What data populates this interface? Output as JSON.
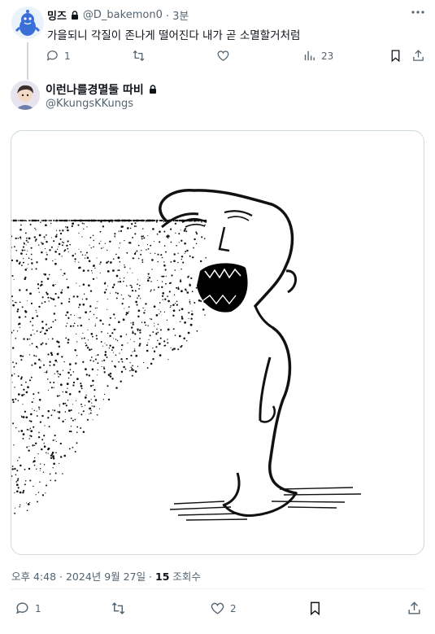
{
  "parent_tweet": {
    "display_name": "밍즈",
    "handle": "@D_bakemon0",
    "time": "· 3분",
    "text": "가을되니 각질이 존나게 떨어진다 내가 곧 소멸할거처럼",
    "replies": "1",
    "views": "23"
  },
  "main_tweet": {
    "display_name": "이런나를경멸둘 따비",
    "handle": "@KkungsKKungs",
    "timestamp": "오후 4:48 · 2024년 9월 27일 · ",
    "views_count": "15",
    "views_label": " 조회수",
    "replies": "1",
    "likes": "2"
  },
  "icons": {
    "lock": "lock-icon",
    "reply": "reply-icon",
    "retweet": "retweet-icon",
    "like": "heart-icon",
    "views": "views-icon",
    "bookmark": "bookmark-icon",
    "share": "share-icon",
    "more": "more-icon"
  },
  "colors": {
    "text": "#0f1419",
    "muted": "#536471",
    "border": "#cfd9de"
  }
}
